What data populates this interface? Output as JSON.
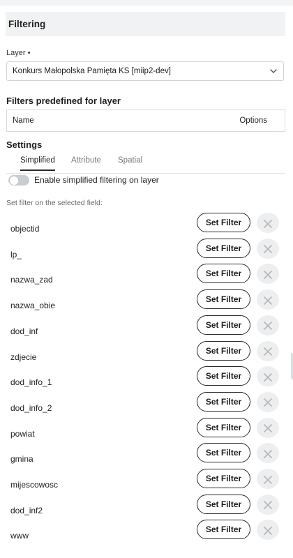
{
  "panel": {
    "title": "Filtering"
  },
  "layer": {
    "label": "Layer •",
    "selected": "Konkurs Małopolska Pamięta KS [miip2-dev]"
  },
  "predefined": {
    "title": "Filters predefined for layer",
    "columns": [
      "Name",
      "Options"
    ]
  },
  "settings": {
    "title": "Settings",
    "tabs": [
      "Simplified",
      "Attribute",
      "Spatial"
    ],
    "active_tab": "Simplified",
    "toggle_label": "Enable simplified filtering on layer",
    "toggle_on": false,
    "hint": "Set filter on the selected field:"
  },
  "set_filter_label": "Set Filter",
  "fields": [
    "objectid",
    "lp_",
    "nazwa_zad",
    "nazwa_obie",
    "dod_inf",
    "zdjecie",
    "dod_info_1",
    "dod_info_2",
    "powiat",
    "gmina",
    "mijescowosc",
    "dod_inf2",
    "www"
  ],
  "icons": {
    "select": "chevron-down-icon",
    "clear": "close-icon"
  },
  "colors": {
    "header_bg": "#f1f2f3",
    "button_border": "#2b2b2b",
    "clear_bg": "#edeeef",
    "toggle_off": "#c9cdd0"
  }
}
